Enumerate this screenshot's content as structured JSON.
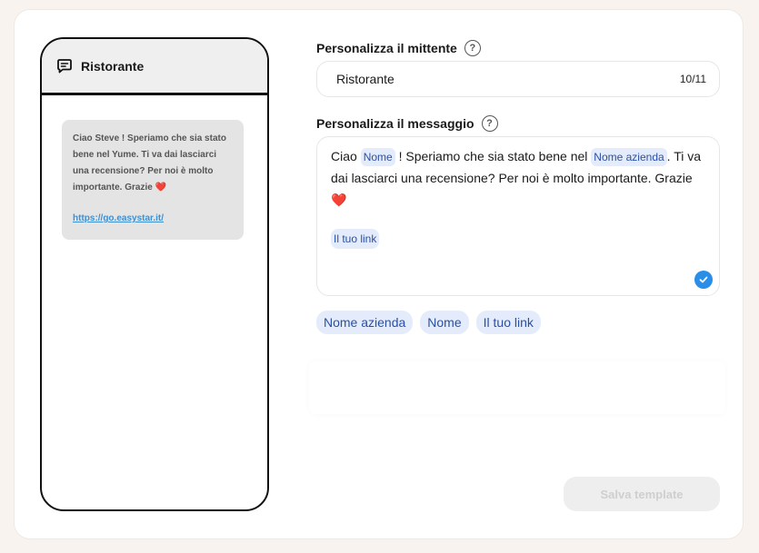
{
  "preview": {
    "sender_name": "Ristorante",
    "message_text": "Ciao Steve ! Speriamo che sia stato bene nel Yume. Ti va dai lasciarci una recensione? Per noi è molto importante. Grazie",
    "heart": "❤️",
    "link": "https://go.easystar.it/"
  },
  "sender": {
    "label": "Personalizza il mittente",
    "help": "?",
    "value": "Ristorante",
    "counter": "10/11"
  },
  "message": {
    "label": "Personalizza il messaggio",
    "help": "?",
    "part1": "Ciao",
    "chip_name": "Nome",
    "part2": "! Speriamo che sia stato bene nel",
    "chip_company": "Nome azienda",
    "part3": ". Ti va dai lasciarci una recensione? Per noi è molto importante. Grazie",
    "heart": "❤️",
    "chip_link": "Il tuo link"
  },
  "tags": {
    "company": "Nome azienda",
    "name": "Nome",
    "link": "Il tuo link"
  },
  "actions": {
    "save": "Salva template"
  },
  "colors": {
    "accent": "#2a8ee8",
    "chip_bg": "#e4ecfb",
    "chip_text": "#2a4fa8",
    "background": "#f8f3ef"
  },
  "icons": {
    "sender": "chat-bubble-icon",
    "help": "question-circle-icon",
    "valid": "check-circle-icon"
  }
}
